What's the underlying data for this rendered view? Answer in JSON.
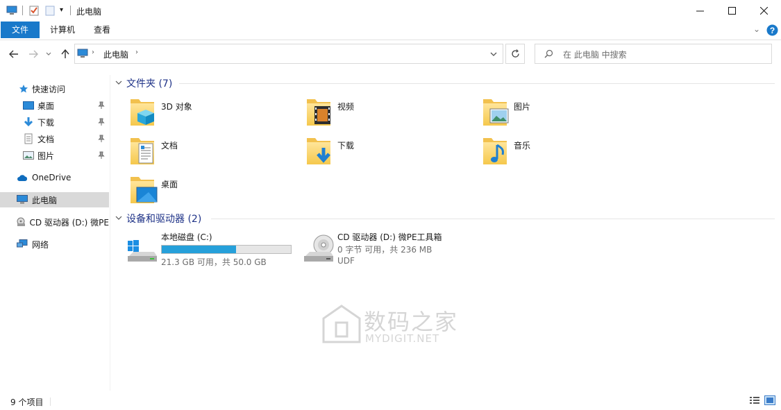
{
  "window": {
    "title": "此电脑",
    "controls": [
      "minimize-icon",
      "maximize-icon",
      "close-icon"
    ]
  },
  "ribbon": {
    "tabs": [
      {
        "label": "文件",
        "active": true
      },
      {
        "label": "计算机",
        "active": false
      },
      {
        "label": "查看",
        "active": false
      }
    ]
  },
  "address": {
    "crumb": "此电脑",
    "search_placeholder": "在 此电脑 中搜索"
  },
  "sidebar": {
    "quick_access": "快速访问",
    "quick_items": [
      {
        "label": "桌面",
        "icon": "desktop-icon"
      },
      {
        "label": "下载",
        "icon": "download-icon"
      },
      {
        "label": "文档",
        "icon": "document-icon"
      },
      {
        "label": "图片",
        "icon": "picture-icon"
      }
    ],
    "onedrive": "OneDrive",
    "this_pc": "此电脑",
    "cd_drive": "CD 驱动器 (D:) 微PE",
    "network": "网络"
  },
  "folders": {
    "header": "文件夹 (7)",
    "items": [
      {
        "label": "3D 对象",
        "icon": "3d-objects-folder-icon"
      },
      {
        "label": "视频",
        "icon": "videos-folder-icon"
      },
      {
        "label": "图片",
        "icon": "pictures-folder-icon"
      },
      {
        "label": "文档",
        "icon": "documents-folder-icon"
      },
      {
        "label": "下载",
        "icon": "downloads-folder-icon"
      },
      {
        "label": "音乐",
        "icon": "music-folder-icon"
      },
      {
        "label": "桌面",
        "icon": "desktop-folder-icon"
      }
    ]
  },
  "devices": {
    "header": "设备和驱动器 (2)",
    "drives": [
      {
        "name": "本地磁盘 (C:)",
        "detail": "21.3 GB 可用，共 50.0 GB",
        "used_fraction": 0.574
      },
      {
        "name": "CD 驱动器 (D:) 微PE工具箱",
        "detail": "0 字节 可用，共 236 MB",
        "fs": "UDF"
      }
    ]
  },
  "status": {
    "count": "9 个项目"
  },
  "watermark": {
    "cn": "数码之家",
    "en": "MYDIGIT.NET"
  },
  "colors": {
    "accent": "#1979ca",
    "group_header": "#1e3287",
    "drive_bar": "#26a0da",
    "selection": "#d9d9d9"
  }
}
